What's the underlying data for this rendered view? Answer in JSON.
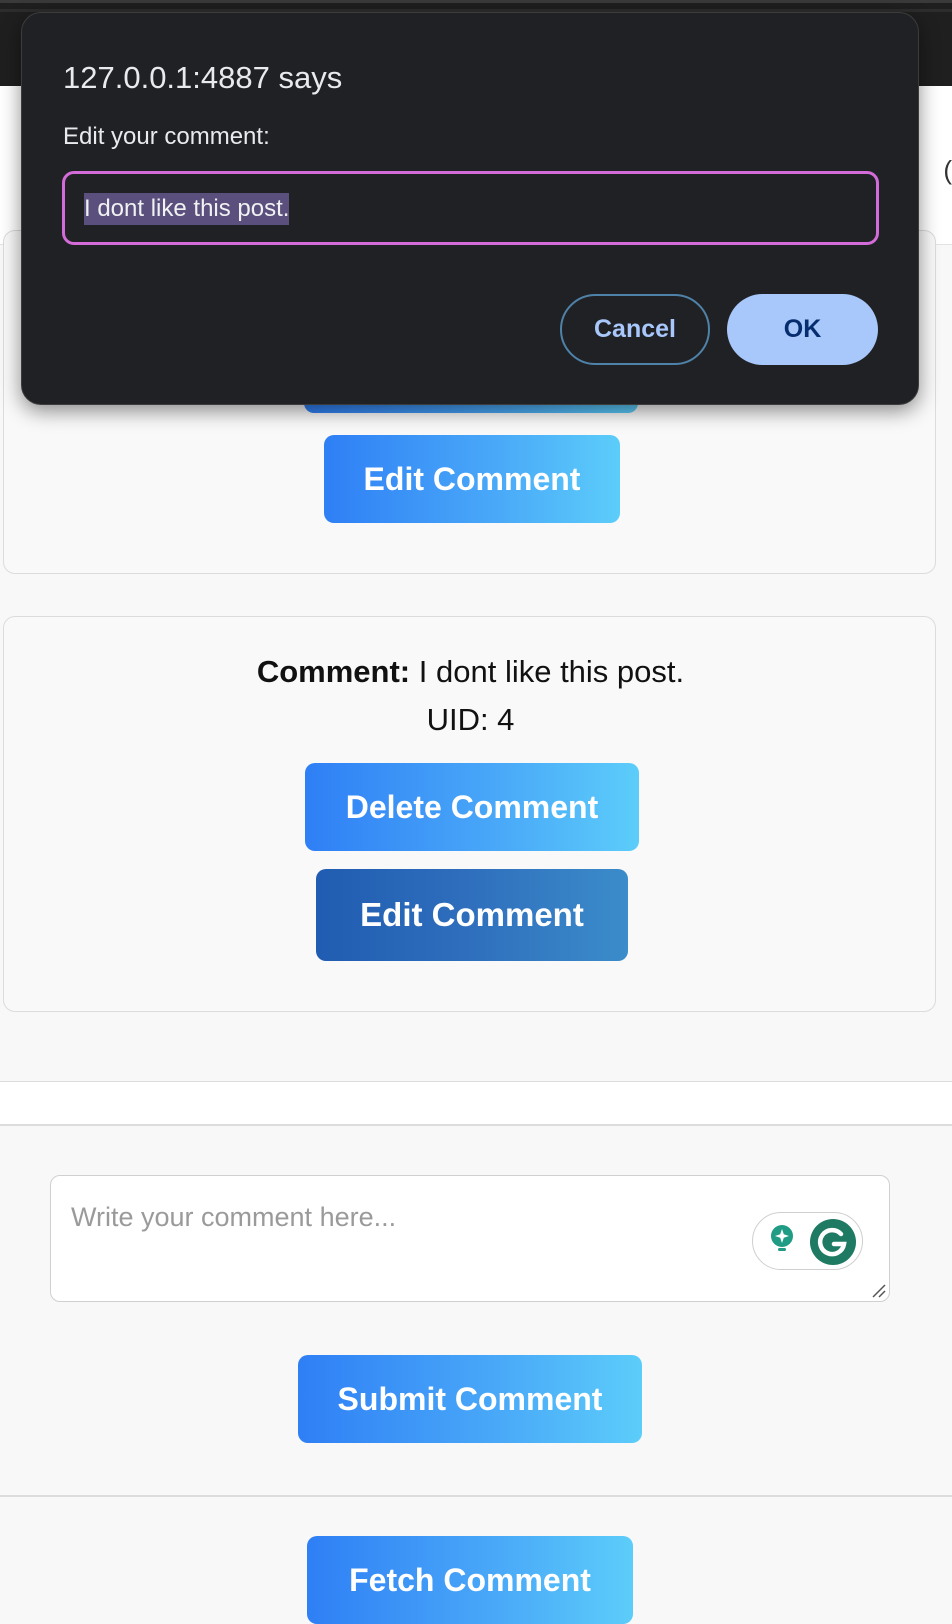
{
  "dialog": {
    "title": "127.0.0.1:4887 says",
    "message": "Edit your comment:",
    "input_value": "I dont like this post.",
    "cancel_label": "Cancel",
    "ok_label": "OK"
  },
  "cards": [
    {
      "edit_label": "Edit Comment"
    },
    {
      "comment_label": "Comment:",
      "comment_text": "I dont like this post.",
      "uid_text": "UID: 4",
      "delete_label": "Delete Comment",
      "edit_label": "Edit Comment"
    }
  ],
  "form": {
    "placeholder": "Write your comment here...",
    "submit_label": "Submit Comment",
    "fetch_label": "Fetch Comment"
  },
  "colors": {
    "accent": "#2f7ff5",
    "accent_light": "#5ccdfa",
    "hover_dark": "#205cb1",
    "dialog_bg": "#202124",
    "focus_ring": "#d36bd9",
    "grammarly": "#1f7a63"
  },
  "icons": {
    "grammarly_suggest": "lightbulb-sparkle-icon",
    "grammarly_logo": "grammarly-g-icon",
    "resize": "resize-grip-icon"
  }
}
